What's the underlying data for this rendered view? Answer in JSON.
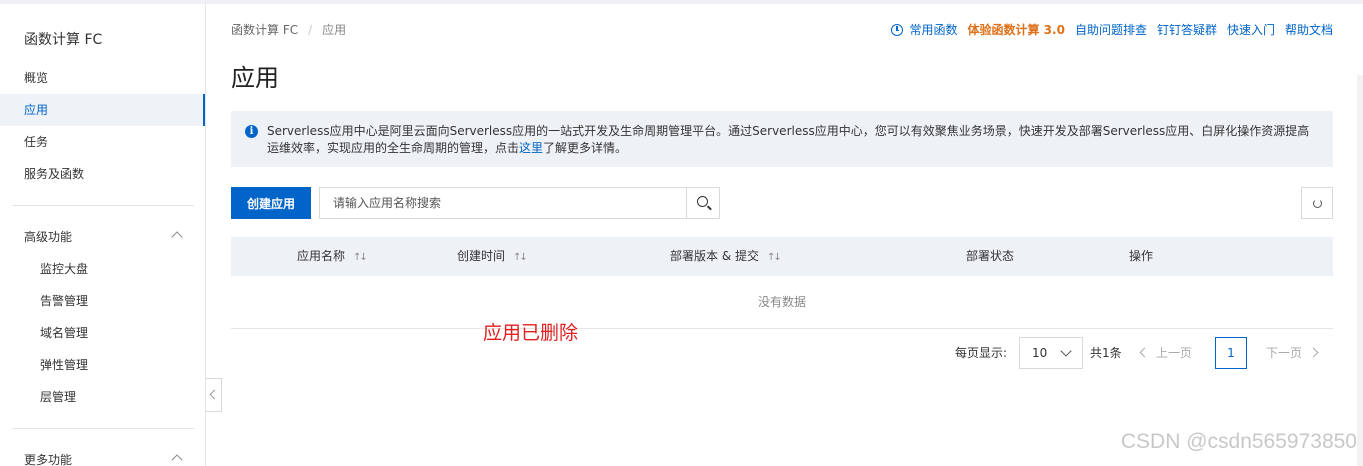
{
  "sidebar": {
    "title": "函数计算 FC",
    "items": [
      {
        "label": "概览"
      },
      {
        "label": "应用",
        "active": true
      },
      {
        "label": "任务"
      },
      {
        "label": "服务及函数"
      }
    ],
    "advanced": {
      "title": "高级功能",
      "items": [
        {
          "label": "监控大盘"
        },
        {
          "label": "告警管理"
        },
        {
          "label": "域名管理"
        },
        {
          "label": "弹性管理"
        },
        {
          "label": "层管理"
        }
      ]
    },
    "more": {
      "title": "更多功能"
    }
  },
  "breadcrumb": {
    "root": "函数计算 FC",
    "separator": "/",
    "current": "应用"
  },
  "top_links": {
    "common_functions": "常用函数",
    "try_fc3": "体验函数计算 3.0",
    "self_diagnose": "自助问题排查",
    "dingtalk": "钉钉答疑群",
    "quick_start": "快速入门",
    "help_docs": "帮助文档"
  },
  "page_title": "应用",
  "notice": {
    "text_before": "Serverless应用中心是阿里云面向Serverless应用的一站式开发及生命周期管理平台。通过Serverless应用中心，您可以有效聚焦业务场景，快速开发及部署Serverless应用、白屏化操作资源提高运维效率，实现应用的全生命周期的管理，点击",
    "link": "这里",
    "text_after": "了解更多详情。"
  },
  "toolbar": {
    "create_label": "创建应用",
    "search_placeholder": "请输入应用名称搜索"
  },
  "table": {
    "columns": [
      "应用名称",
      "创建时间",
      "部署版本 & 提交",
      "部署状态",
      "操作"
    ],
    "empty_text": "没有数据"
  },
  "annotation": "应用已删除",
  "pagination": {
    "per_page_label": "每页显示:",
    "page_size": "10",
    "total": "共1条",
    "prev": "上一页",
    "current_page": "1",
    "next": "下一页"
  },
  "watermark": "CSDN @csdn565973850",
  "colors": {
    "accent": "#0064c8",
    "orange": "#e0711a",
    "annotation_red": "#e02020"
  }
}
